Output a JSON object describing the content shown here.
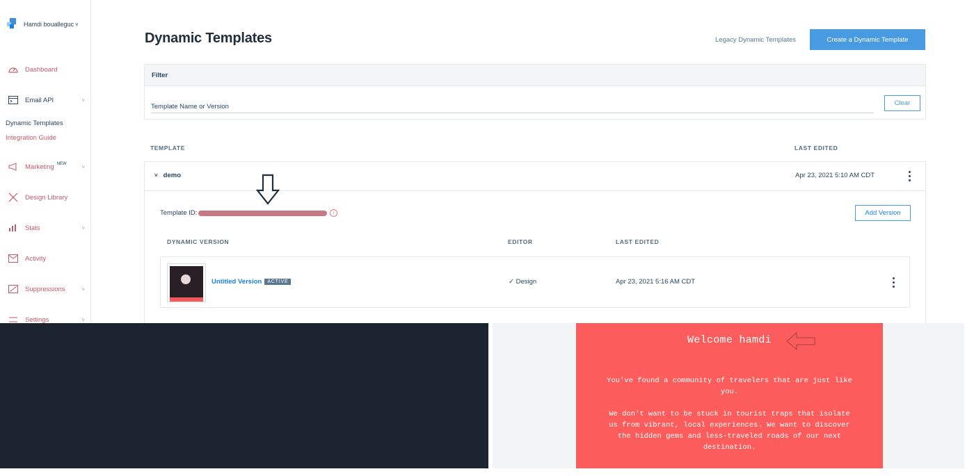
{
  "user": {
    "name": "Hamdi boualleguc"
  },
  "sidebar": {
    "items": [
      {
        "label": "Dashboard",
        "icon": "dashboard-icon"
      },
      {
        "label": "Email API",
        "icon": "email-api-icon"
      },
      {
        "label": "Marketing",
        "badge": "NEW",
        "icon": "megaphone-icon"
      },
      {
        "label": "Design Library",
        "icon": "design-library-icon"
      },
      {
        "label": "Stats",
        "icon": "stats-icon"
      },
      {
        "label": "Activity",
        "icon": "activity-icon"
      },
      {
        "label": "Suppressions",
        "icon": "suppressions-icon"
      },
      {
        "label": "Settings",
        "icon": "settings-icon"
      }
    ],
    "sub_items": [
      "Dynamic Templates",
      "Integration Guide"
    ]
  },
  "header": {
    "title": "Dynamic Templates",
    "legacy_link": "Legacy Dynamic Templates",
    "create_button": "Create a Dynamic Template"
  },
  "filter": {
    "heading": "Filter",
    "placeholder": "Template Name or Version",
    "clear_label": "Clear"
  },
  "table": {
    "col_template": "TEMPLATE",
    "col_last_edited": "LAST EDITED"
  },
  "template": {
    "name": "demo",
    "last_edited": "Apr 23, 2021 5:10 AM CDT",
    "id_label": "Template ID:",
    "add_version_label": "Add Version",
    "versions_headers": {
      "version": "DYNAMIC VERSION",
      "editor": "EDITOR",
      "last_edited": "LAST EDITED"
    },
    "version": {
      "name": "Untitled Version",
      "status": "ACTIVE",
      "editor": "Design",
      "last_edited": "Apr 23, 2021 5:16 AM CDT"
    }
  },
  "email_preview": {
    "heading": "Welcome hamdi",
    "paragraph1": "You've found a community of travelers that are just like you.",
    "paragraph2": "We don't want to be stuck in tourist traps that isolate us from vibrant, local experiences. We want to discover the hidden gems and less-traveled roads of our next destination."
  },
  "colors": {
    "primary": "#489be0",
    "link_red": "#c35a6a",
    "email_bg": "#fc5c5c",
    "dark_panel": "#1c2430"
  }
}
